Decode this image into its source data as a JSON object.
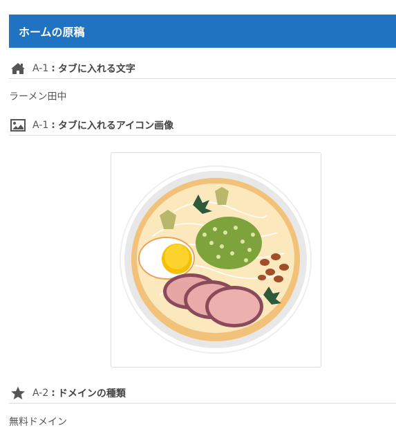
{
  "header": {
    "title": "ホームの原稿"
  },
  "sections": [
    {
      "icon": "home-icon",
      "code": "A-1",
      "sep": ":",
      "title": "タブに入れる文字",
      "value": "ラーメン田中"
    },
    {
      "icon": "image-icon",
      "code": "A-1",
      "sep": ":",
      "title": "タブに入れるアイコン画像"
    },
    {
      "icon": "star-icon",
      "code": "A-2",
      "sep": ":",
      "title": "ドメインの種類",
      "value": "無料ドメイン"
    }
  ],
  "colors": {
    "header_bg": "#1f73c0",
    "divider": "#dedede",
    "text": "#555555"
  }
}
